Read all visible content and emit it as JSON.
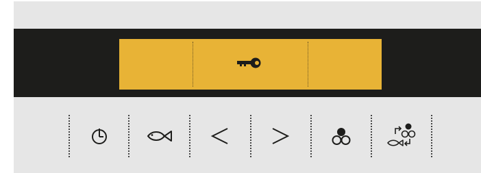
{
  "display": {
    "status_icon": "key-icon",
    "background_color": "#e8b336",
    "segments": 3
  },
  "controls": {
    "buttons": [
      {
        "id": "timer",
        "icon": "timer-icon"
      },
      {
        "id": "fish",
        "icon": "fish-icon"
      },
      {
        "id": "left",
        "icon": "chevron-left-icon"
      },
      {
        "id": "right",
        "icon": "chevron-right-icon"
      },
      {
        "id": "circles",
        "icon": "three-circles-icon"
      },
      {
        "id": "fish-cycle",
        "icon": "fish-cycle-icon"
      }
    ]
  },
  "colors": {
    "panel": "#e6e6e6",
    "band": "#1d1d1b",
    "icon": "#1d1d1b"
  }
}
